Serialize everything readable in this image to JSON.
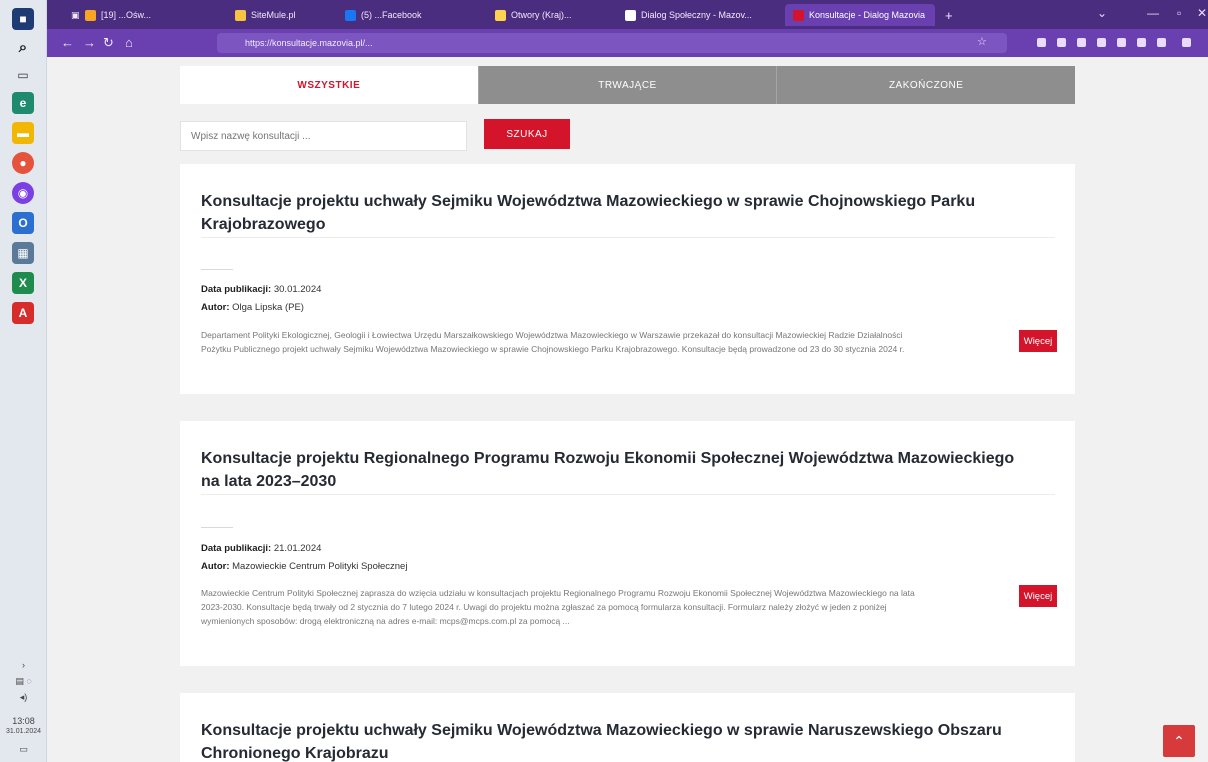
{
  "browser": {
    "tabs": [
      {
        "label": "[19] ...Ośw...",
        "color": "#f5a623"
      },
      {
        "label": "SiteMule.pl",
        "color": "#f5c542"
      },
      {
        "label": "(5) ...Facebook",
        "color": "#1877f2"
      },
      {
        "label": "Otwory (Kraj)...",
        "color": "#ffd34d"
      },
      {
        "label": "Dialog Społeczny - Mazov...",
        "color": "#ffffff"
      },
      {
        "label": "Konsultacje - Dialog Mazovia",
        "color": "#d3142a"
      }
    ],
    "url": "https://konsultacje.mazovia.pl/..."
  },
  "filters": {
    "tab_all": "WSZYSTKIE",
    "tab_ongoing": "TRWAJĄCE",
    "tab_finished": "ZAKOŃCZONE",
    "search_placeholder": "Wpisz nazwę konsultacji ...",
    "search_button": "SZUKAJ"
  },
  "consultations": [
    {
      "title": "Konsultacje projektu uchwały Sejmiku Województwa Mazowieckiego w sprawie Chojnowskiego Parku Krajobrazowego",
      "date_label": "Data publikacji:",
      "date": "30.01.2024",
      "author_label": "Autor:",
      "author": "Olga Lipska (PE)",
      "description": "Departament Polityki Ekologicznej, Geologii i Łowiectwa Urzędu Marszałkowskiego Województwa Mazowieckiego w Warszawie przekazał do konsultacji Mazowieckiej Radzie Działalności Pożytku Publicznego projekt uchwały Sejmiku Województwa Mazowieckiego w sprawie Chojnowskiego Parku Krajobrazowego. Konsultacje będą prowadzone od 23 do 30 stycznia 2024 r.",
      "more": "Więcej"
    },
    {
      "title": "Konsultacje projektu Regionalnego Programu Rozwoju Ekonomii Społecznej Województwa Mazowieckiego na lata 2023–2030",
      "date_label": "Data publikacji:",
      "date": "21.01.2024",
      "author_label": "Autor:",
      "author": "Mazowieckie Centrum Polityki Społecznej",
      "description": "Mazowieckie Centrum Polityki Społecznej zaprasza do wzięcia udziału w konsultacjach projektu Regionalnego Programu Rozwoju Ekonomii Społecznej Województwa Mazowieckiego na lata 2023-2030. Konsultacje będą trwały od 2 stycznia do 7 lutego 2024 r. Uwagi do projektu można zgłaszać za pomocą formularza konsultacji. Formularz należy złożyć w jeden z poniżej wymienionych sposobów: drogą elektroniczną na adres e-mail: mcps@mcps.com.pl za pomocą ...",
      "more": "Więcej"
    },
    {
      "title": "Konsultacje projektu uchwały Sejmiku Województwa Mazowieckiego w sprawie Naruszewskiego Obszaru Chronionego Krajobrazu"
    }
  ],
  "system": {
    "time": "13:08",
    "date": "31.01.2024"
  },
  "colors": {
    "accent": "#d3142a",
    "browser_frame": "#4b2d7f"
  }
}
